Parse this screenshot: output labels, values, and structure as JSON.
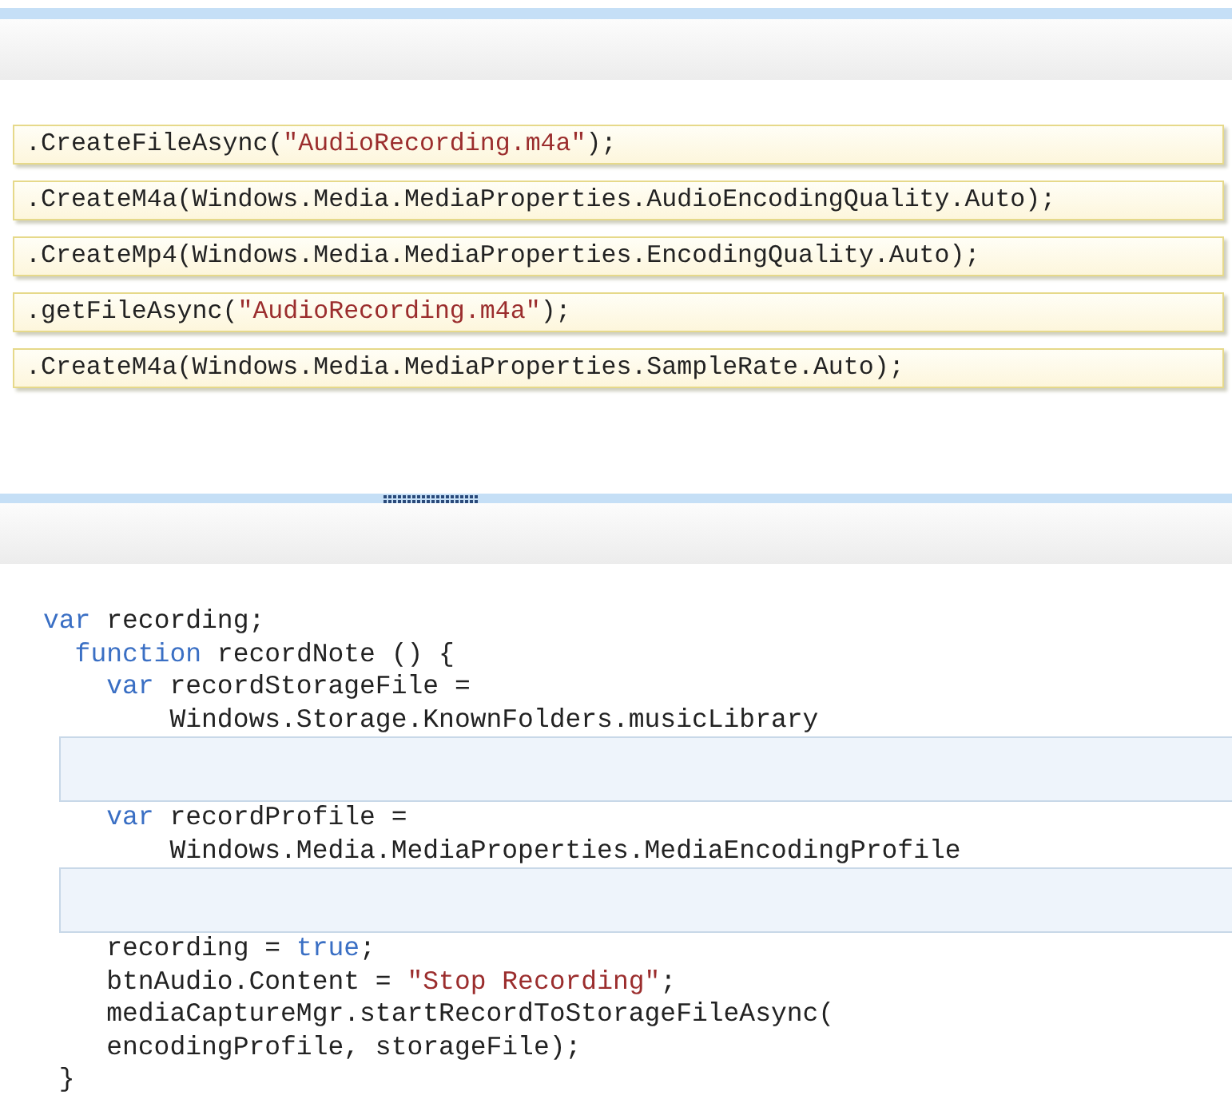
{
  "answer_choices": [
    {
      "segments": [
        {
          "kind": "plain",
          "text": ".CreateFileAsync("
        },
        {
          "kind": "string",
          "text": "\"AudioRecording.m4a\""
        },
        {
          "kind": "plain",
          "text": ");"
        }
      ]
    },
    {
      "segments": [
        {
          "kind": "plain",
          "text": ".CreateM4a(Windows.Media.MediaProperties.AudioEncodingQuality.Auto);"
        }
      ]
    },
    {
      "segments": [
        {
          "kind": "plain",
          "text": ".CreateMp4(Windows.Media.MediaProperties.EncodingQuality.Auto);"
        }
      ]
    },
    {
      "segments": [
        {
          "kind": "plain",
          "text": ".getFileAsync("
        },
        {
          "kind": "string",
          "text": "\"AudioRecording.m4a\""
        },
        {
          "kind": "plain",
          "text": ");"
        }
      ]
    },
    {
      "segments": [
        {
          "kind": "plain",
          "text": ".CreateM4a(Windows.Media.MediaProperties.SampleRate.Auto);"
        }
      ]
    }
  ],
  "code": [
    {
      "kind": "line",
      "segments": [
        {
          "kind": "keyword",
          "text": "var"
        },
        {
          "kind": "plain",
          "text": " recording;"
        }
      ]
    },
    {
      "kind": "line",
      "segments": [
        {
          "kind": "keyword",
          "text": "  function"
        },
        {
          "kind": "plain",
          "text": " recordNote () {"
        }
      ]
    },
    {
      "kind": "line",
      "segments": [
        {
          "kind": "keyword",
          "text": "    var"
        },
        {
          "kind": "plain",
          "text": " recordStorageFile ="
        }
      ]
    },
    {
      "kind": "line",
      "segments": [
        {
          "kind": "plain",
          "text": "        Windows.Storage.KnownFolders.musicLibrary"
        }
      ]
    },
    {
      "kind": "drop-target"
    },
    {
      "kind": "line",
      "segments": [
        {
          "kind": "keyword",
          "text": "    var"
        },
        {
          "kind": "plain",
          "text": " recordProfile ="
        }
      ]
    },
    {
      "kind": "line",
      "segments": [
        {
          "kind": "plain",
          "text": "        Windows.Media.MediaProperties.MediaEncodingProfile"
        }
      ]
    },
    {
      "kind": "drop-target"
    },
    {
      "kind": "line",
      "segments": [
        {
          "kind": "plain",
          "text": "    recording = "
        },
        {
          "kind": "keyword",
          "text": "true"
        },
        {
          "kind": "plain",
          "text": ";"
        }
      ]
    },
    {
      "kind": "line",
      "segments": [
        {
          "kind": "plain",
          "text": "    btnAudio.Content = "
        },
        {
          "kind": "string",
          "text": "\"Stop Recording\""
        },
        {
          "kind": "plain",
          "text": ";"
        }
      ]
    },
    {
      "kind": "line",
      "segments": [
        {
          "kind": "plain",
          "text": "    mediaCaptureMgr.startRecordToStorageFileAsync("
        }
      ]
    },
    {
      "kind": "line",
      "segments": [
        {
          "kind": "plain",
          "text": "    encodingProfile, storageFile);"
        }
      ]
    },
    {
      "kind": "line",
      "segments": [
        {
          "kind": "plain",
          "text": " }"
        }
      ]
    }
  ]
}
